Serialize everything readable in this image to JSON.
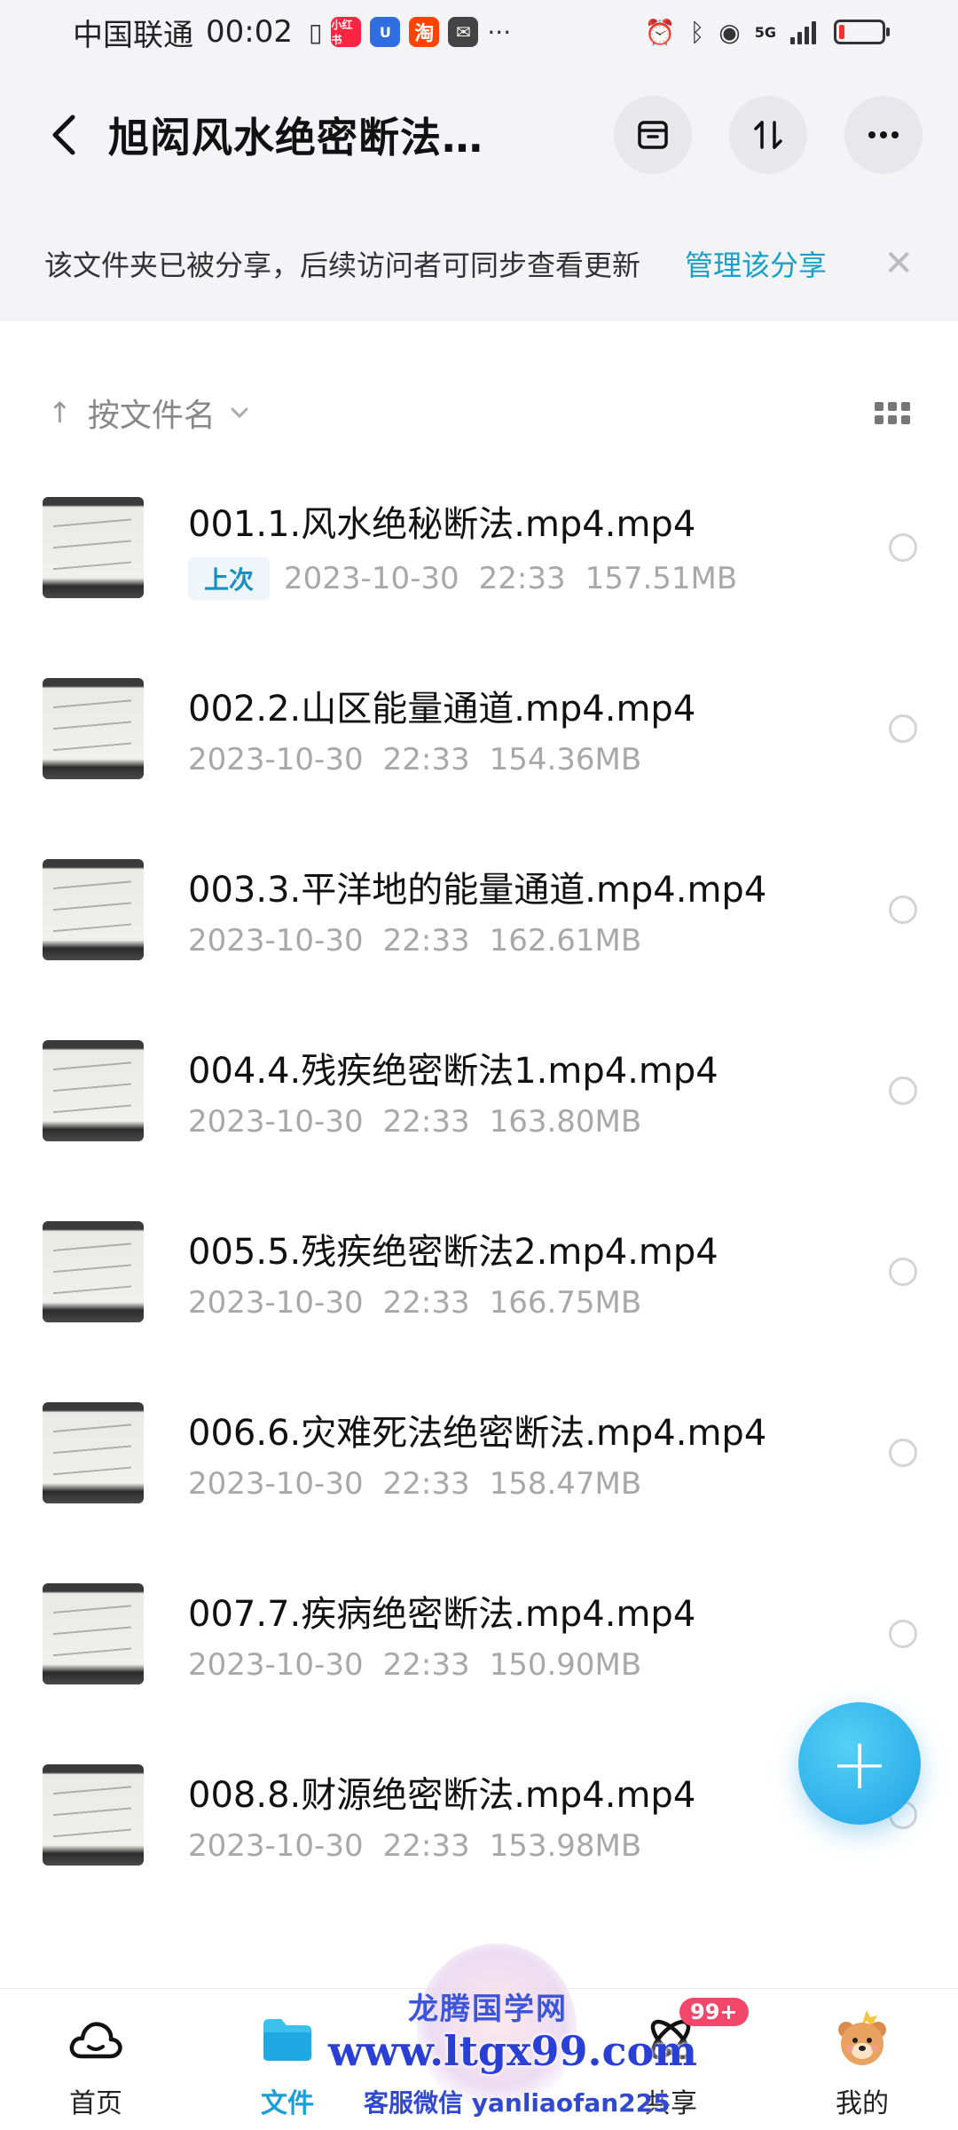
{
  "status_bar": {
    "carrier": "中国联通",
    "time": "00:02",
    "app_badges": [
      {
        "name": "xiaohongshu",
        "text": "小红书",
        "color": "#ff2442"
      },
      {
        "name": "app-u",
        "text": "U",
        "color": "#2f6de1"
      },
      {
        "name": "taobao",
        "text": "淘",
        "color": "#ff4400"
      },
      {
        "name": "app-mail",
        "text": "✉",
        "color": "#444444"
      }
    ],
    "more": "···",
    "network": "5G",
    "battery_level": 0.12
  },
  "header": {
    "title": "旭闳风水绝密断法…",
    "actions": [
      "archive-icon",
      "sort-updown-icon",
      "more-icon"
    ]
  },
  "share_notice": {
    "text": "该文件夹已被分享，后续访问者可同步查看更新",
    "link": "管理该分享",
    "close": "✕"
  },
  "sort": {
    "arrow": "↑",
    "label": "按文件名",
    "caret": "⌄"
  },
  "files": [
    {
      "name": "001.1.风水绝秘断法.mp4.mp4",
      "tag": "上次",
      "date": "2023-10-30",
      "time": "22:33",
      "size": "157.51MB"
    },
    {
      "name": "002.2.山区能量通道.mp4.mp4",
      "tag": "",
      "date": "2023-10-30",
      "time": "22:33",
      "size": "154.36MB"
    },
    {
      "name": "003.3.平洋地的能量通道.mp4.mp4",
      "tag": "",
      "date": "2023-10-30",
      "time": "22:33",
      "size": "162.61MB"
    },
    {
      "name": "004.4.残疾绝密断法1.mp4.mp4",
      "tag": "",
      "date": "2023-10-30",
      "time": "22:33",
      "size": "163.80MB"
    },
    {
      "name": "005.5.残疾绝密断法2.mp4.mp4",
      "tag": "",
      "date": "2023-10-30",
      "time": "22:33",
      "size": "166.75MB"
    },
    {
      "name": "006.6.灾难死法绝密断法.mp4.mp4",
      "tag": "",
      "date": "2023-10-30",
      "time": "22:33",
      "size": "158.47MB"
    },
    {
      "name": "007.7.疾病绝密断法.mp4.mp4",
      "tag": "",
      "date": "2023-10-30",
      "time": "22:33",
      "size": "150.90MB"
    },
    {
      "name": "008.8.财源绝密断法.mp4.mp4",
      "tag": "",
      "date": "2023-10-30",
      "time": "22:33",
      "size": "153.98MB"
    }
  ],
  "fab": {
    "label": "+"
  },
  "bottom_nav": {
    "items": [
      {
        "label": "首页",
        "icon": "cloud-icon",
        "active": false
      },
      {
        "label": "文件",
        "icon": "folder-icon",
        "active": true
      },
      {
        "label": "",
        "icon": "",
        "active": false
      },
      {
        "label": "共享",
        "icon": "orbit-icon",
        "active": false,
        "badge": "99+"
      },
      {
        "label": "我的",
        "icon": "avatar-bear-icon",
        "active": false
      }
    ],
    "accent": "#1aa0d8"
  },
  "watermark": {
    "title": "龙腾国学网",
    "url": "www.ltgx99.com",
    "contact": "客服微信 yanliaofan225"
  }
}
